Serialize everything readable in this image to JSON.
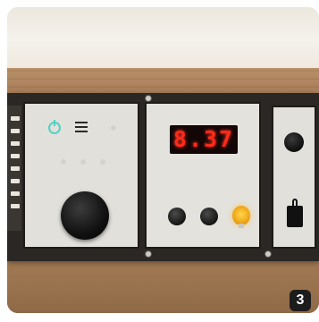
{
  "photo": {
    "display_value": "8.37",
    "badge_number": "3"
  },
  "colors": {
    "display_segment": "#ff2a1a",
    "power_icon": "#4fd3c4",
    "bulb": "#f0a81a",
    "wood": "#8e6744"
  },
  "icons": [
    "power-icon",
    "menu-icon",
    "knob",
    "bulb-icon",
    "toggle-switch-icon"
  ]
}
